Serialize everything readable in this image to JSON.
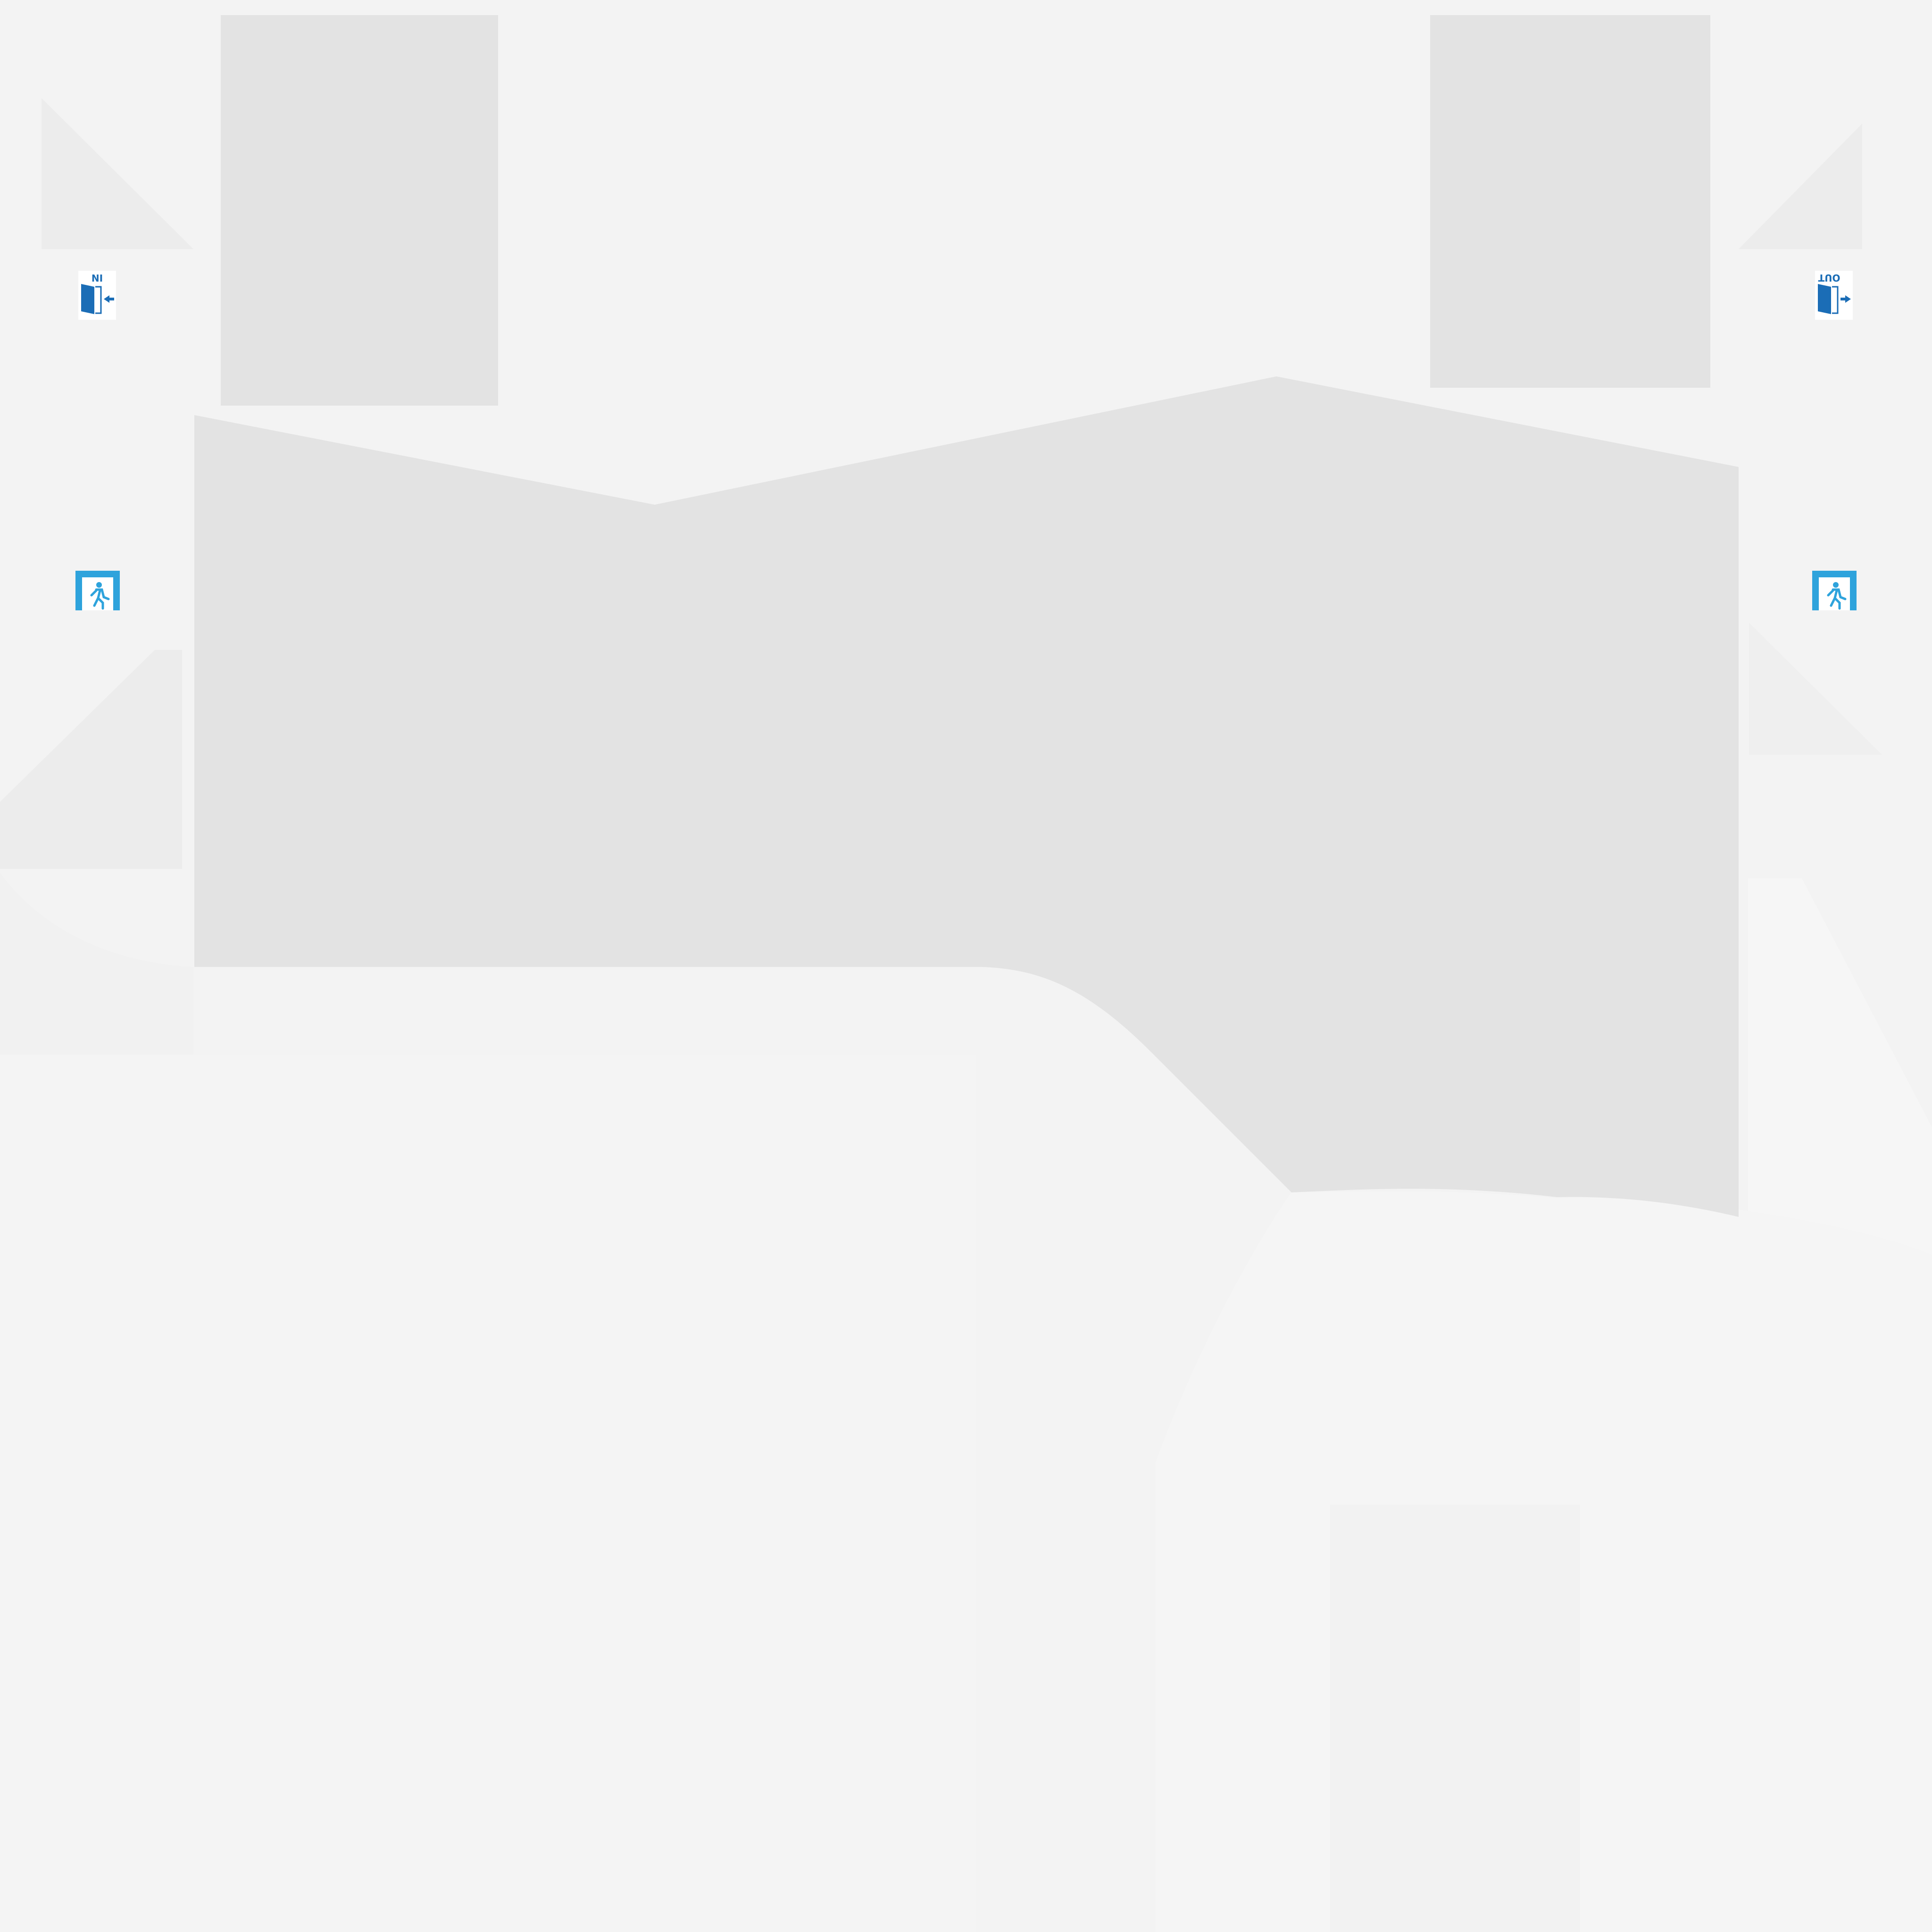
{
  "colors": {
    "background": "#f3f3f3",
    "ground_light": "#f4f4f4",
    "block_fill": "#e3e3e3",
    "white_panel": "#ffffff",
    "door_blue": "#1b6db6",
    "exit_blue": "#2ea3dc"
  },
  "markers": {
    "entrance": {
      "label": "IN",
      "icon": "entrance-door-icon"
    },
    "exit_door": {
      "label": "OUT",
      "icon": "exit-door-icon"
    },
    "emergency_exit": {
      "icon": "emergency-exit-icon"
    }
  }
}
